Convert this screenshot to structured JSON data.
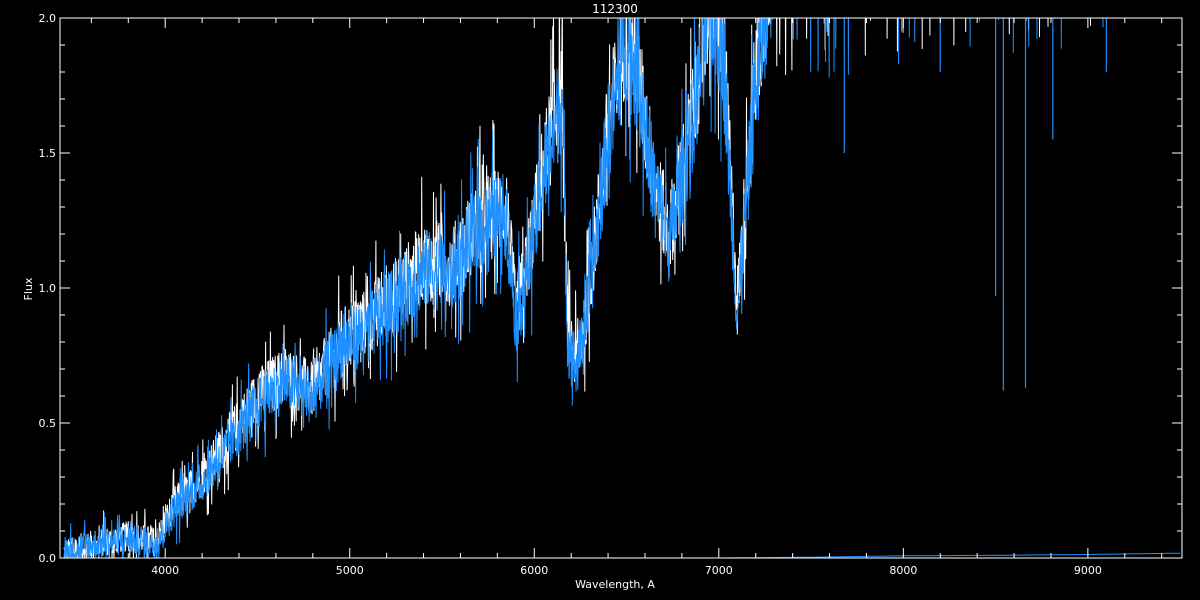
{
  "chart_data": {
    "type": "line",
    "title": "112300",
    "xlabel": "Wavelength, A",
    "ylabel": "Flux",
    "xlim": [
      3430,
      9510
    ],
    "ylim": [
      0,
      2.0
    ],
    "xticks": [
      4000,
      5000,
      6000,
      7000,
      8000,
      9000
    ],
    "yticks": [
      0.0,
      0.5,
      1.0,
      1.5,
      2.0
    ],
    "ytick_labels": [
      "0.0",
      "0.5",
      "1.0",
      "1.5",
      "2.0"
    ],
    "grid": false,
    "background": "#000000",
    "axes_color": "#ffffff",
    "series": [
      {
        "color": "#ffffff",
        "x": [
          3450,
          3600,
          3800,
          3950,
          4050,
          4200,
          4350,
          4500,
          4650,
          4800,
          4950,
          5100,
          5250,
          5400,
          5550,
          5700,
          5850,
          5900,
          5950,
          6050,
          6150,
          6180,
          6230,
          6300,
          6400,
          6500,
          6560,
          6650,
          6730,
          6850,
          6950,
          7020,
          7100,
          7200,
          7300,
          7600,
          8000,
          8500,
          9000,
          9500
        ],
        "values": [
          0.02,
          0.05,
          0.08,
          0.06,
          0.2,
          0.3,
          0.45,
          0.6,
          0.68,
          0.62,
          0.8,
          0.88,
          0.98,
          1.1,
          1.08,
          1.25,
          1.3,
          0.9,
          1.05,
          1.45,
          1.75,
          0.85,
          0.72,
          1.0,
          1.6,
          1.95,
          1.8,
          1.4,
          1.2,
          1.6,
          2.1,
          1.95,
          0.95,
          1.8,
          2.3,
          2.35,
          2.4,
          2.45,
          2.5,
          2.5
        ]
      },
      {
        "color": "#1e90ff",
        "x": [
          3450,
          3600,
          3800,
          3950,
          4050,
          4200,
          4350,
          4500,
          4650,
          4800,
          4950,
          5100,
          5250,
          5400,
          5550,
          5700,
          5850,
          5900,
          5950,
          6050,
          6150,
          6180,
          6230,
          6300,
          6400,
          6500,
          6560,
          6650,
          6730,
          6850,
          6950,
          7020,
          7100,
          7200,
          7300,
          7600,
          8000,
          8500,
          9000,
          9500
        ],
        "values": [
          0.02,
          0.05,
          0.07,
          0.05,
          0.18,
          0.28,
          0.42,
          0.57,
          0.65,
          0.6,
          0.78,
          0.85,
          0.95,
          1.07,
          1.05,
          1.22,
          1.27,
          0.88,
          1.02,
          1.42,
          1.72,
          0.82,
          0.7,
          0.97,
          1.57,
          1.92,
          1.77,
          1.38,
          1.17,
          1.57,
          2.05,
          1.9,
          0.9,
          1.75,
          2.25,
          2.3,
          2.35,
          2.4,
          2.45,
          2.45
        ]
      },
      {
        "color": "#1e90ff",
        "x": [
          3450,
          4000,
          5000,
          6000,
          7000,
          7500,
          8000,
          8500,
          9000,
          9500
        ],
        "values": [
          0.0,
          0.0,
          0.0,
          0.0,
          0.0,
          0.003,
          0.008,
          0.01,
          0.013,
          0.018
        ]
      }
    ],
    "absorption_lines": [
      {
        "x": 7680,
        "depth_to": 1.5
      },
      {
        "x": 8200,
        "depth_to": 1.8
      },
      {
        "x": 8500,
        "depth_to": 0.97
      },
      {
        "x": 8542,
        "depth_to": 0.62
      },
      {
        "x": 8662,
        "depth_to": 0.63
      },
      {
        "x": 8810,
        "depth_to": 1.55
      },
      {
        "x": 9100,
        "depth_to": 1.8
      }
    ]
  }
}
